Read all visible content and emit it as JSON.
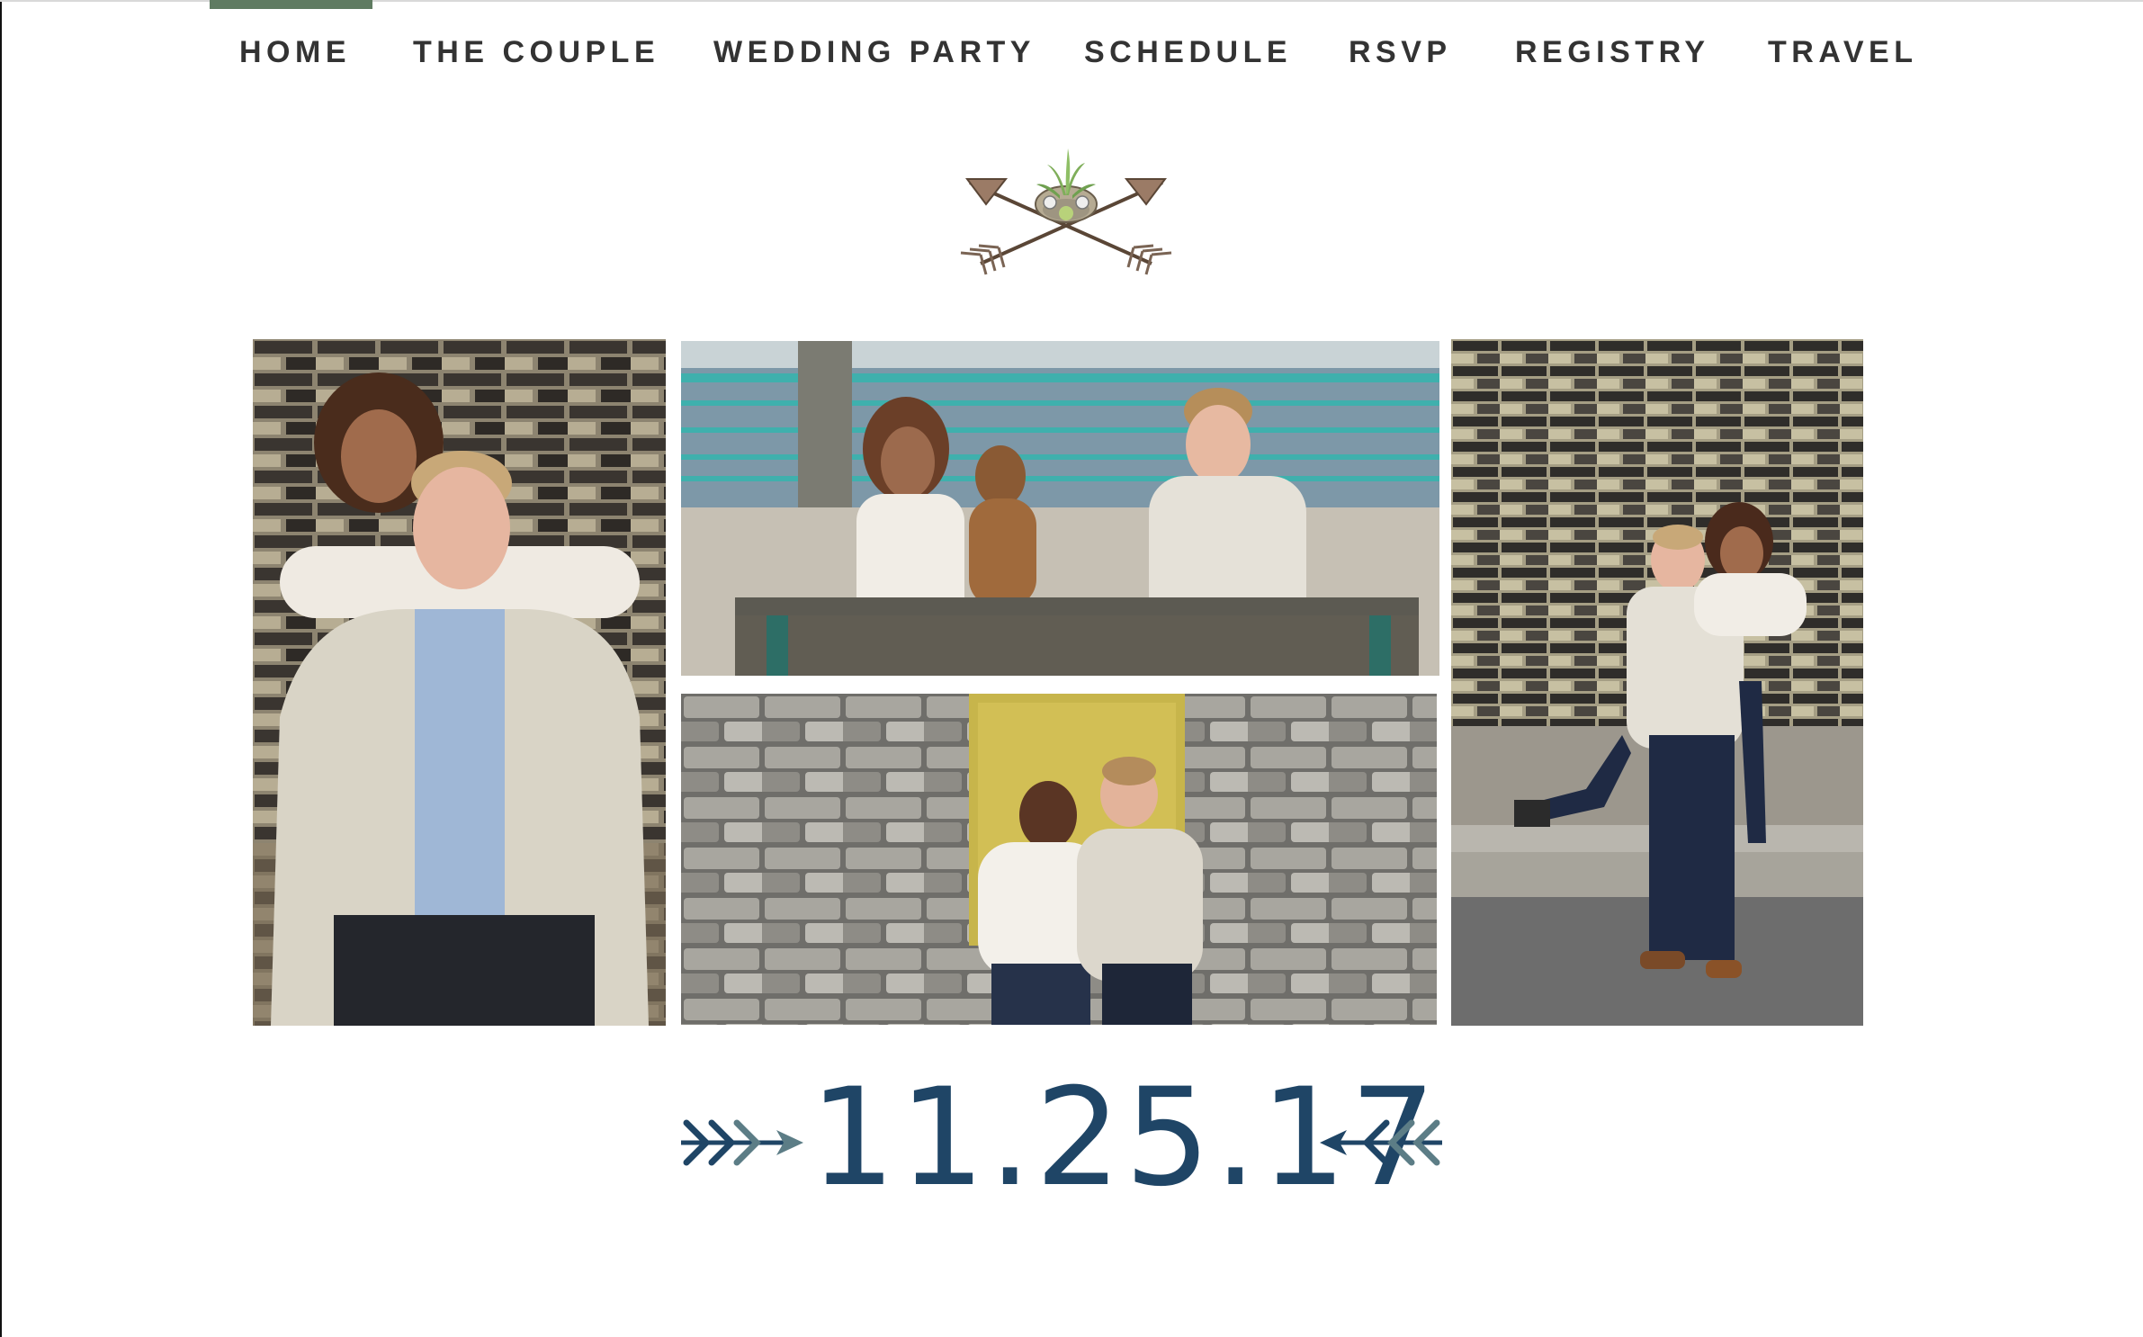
{
  "nav": {
    "items": [
      {
        "label": "HOME",
        "active": true
      },
      {
        "label": "THE COUPLE",
        "active": false
      },
      {
        "label": "WEDDING PARTY",
        "active": false
      },
      {
        "label": "SCHEDULE",
        "active": false
      },
      {
        "label": "RSVP",
        "active": false
      },
      {
        "label": "REGISTRY",
        "active": false
      },
      {
        "label": "TRAVEL",
        "active": false
      }
    ],
    "active_color": "#5f7b61",
    "text_color": "#333333"
  },
  "emblem": {
    "icon": "crossed-arrows-succulent-icon"
  },
  "gallery": {
    "photos": [
      {
        "name": "couple-hug-brick-wall",
        "description_icon": "photo"
      },
      {
        "name": "couple-bench-waterfront-with-dog",
        "description_icon": "photo"
      },
      {
        "name": "couple-kiss-stone-wall",
        "description_icon": "photo"
      },
      {
        "name": "piggyback-brick-wall",
        "description_icon": "photo"
      }
    ]
  },
  "date": {
    "text": "11.25.17",
    "color": "#1f4566",
    "arrow_color": "#5c7d86"
  }
}
